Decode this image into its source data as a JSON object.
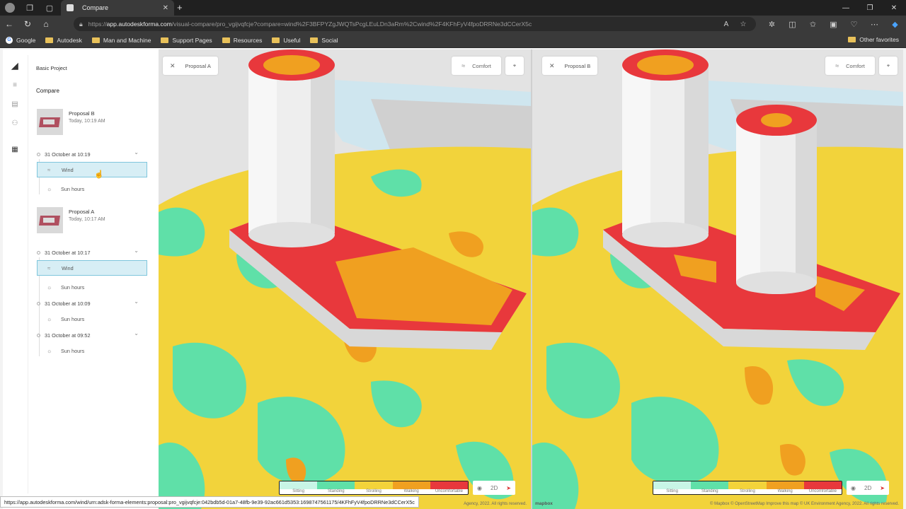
{
  "browser": {
    "tab_title": "Compare",
    "url_host": "app.autodeskforma.com",
    "url_prefix": "https://",
    "url_rest": "/visual-compare/pro_vgijvqfcje?compare=wind%2F3BFPYZgJWQTsPcgLEuLDn3aRm%2Cwind%2F4KFhFyV4fpoDRRNe3dCCerX5c",
    "bookmarks": [
      "Google",
      "Autodesk",
      "Man and Machine",
      "Support Pages",
      "Resources",
      "Useful",
      "Social"
    ],
    "other_favorites": "Other favorites",
    "status_url": "https://app.autodeskforma.com/wind/urn:adsk-forma-elements:proposal:pro_vgijvqfcje:042bdb5d-01a7-48fb-9e39-92ac661d5353:1698747561175/4KFhFyV4fpoDRRNe3dCCerX5c"
  },
  "sidebar": {
    "project_name": "Basic Project",
    "section_title": "Compare",
    "proposals": [
      {
        "name": "Proposal B",
        "time": "Today, 10:19 AM",
        "runs": [
          {
            "date": "31 October at 10:19",
            "items": [
              "Wind",
              "Sun hours"
            ]
          }
        ]
      },
      {
        "name": "Proposal A",
        "time": "Today, 10:17 AM",
        "runs": [
          {
            "date": "31 October at 10:17",
            "items": [
              "Wind",
              "Sun hours"
            ]
          },
          {
            "date": "31 October at 10:09",
            "items": [
              "Sun hours"
            ]
          },
          {
            "date": "31 October at 09:52",
            "items": [
              "Sun hours"
            ]
          }
        ]
      }
    ]
  },
  "viewports": [
    {
      "label": "Proposal A",
      "mode": "Comfort",
      "view": "2D",
      "attribution": "Agency, 2022. All rights reserved."
    },
    {
      "label": "Proposal B",
      "mode": "Comfort",
      "view": "2D",
      "attribution": "© Mapbox © OpenStreetMap Improve this map © UK Environment Agency, 2022. All rights reserved.",
      "mapbox": "mapbox"
    }
  ],
  "legend": {
    "labels": [
      "Sitting",
      "Standing",
      "Strolling",
      "Walking",
      "Uncomfortable"
    ],
    "colors": [
      "#c8f5e6",
      "#5fe0a8",
      "#f3d33a",
      "#f0a020",
      "#e8383c"
    ]
  }
}
